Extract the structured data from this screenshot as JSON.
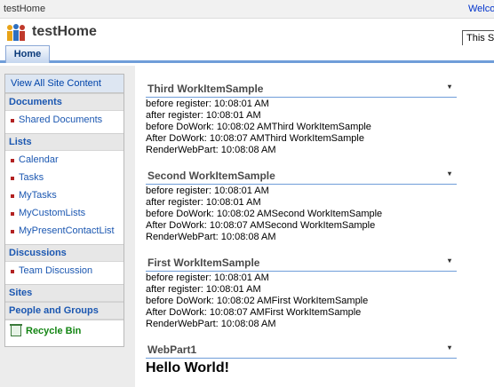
{
  "topbar": {
    "site_name": "testHome",
    "welcome_text": "Welcome"
  },
  "header": {
    "site_title": "testHome",
    "search_value": "This Site"
  },
  "tabs": [
    {
      "label": "Home"
    }
  ],
  "quicklaunch": {
    "view_all": "View All Site Content",
    "documents": {
      "heading": "Documents",
      "items": [
        "Shared Documents"
      ]
    },
    "lists": {
      "heading": "Lists",
      "items": [
        "Calendar",
        "Tasks",
        "MyTasks",
        "MyCustomLists",
        "MyPresentContactList"
      ]
    },
    "discussions": {
      "heading": "Discussions",
      "items": [
        "Team Discussion"
      ]
    },
    "sites": "Sites",
    "people_and_groups": "People and Groups",
    "recycle_bin": "Recycle Bin"
  },
  "webparts": [
    {
      "title": "Third WorkItemSample",
      "menu": "▾",
      "lines": [
        "before register: 10:08:01 AM",
        "after register: 10:08:01 AM",
        "before DoWork: 10:08:02 AMThird WorkItemSample",
        "After DoWork: 10:08:07 AMThird WorkItemSample",
        "RenderWebPart: 10:08:08 AM"
      ]
    },
    {
      "title": "Second WorkItemSample",
      "menu": "▾",
      "lines": [
        "before register: 10:08:01 AM",
        "after register: 10:08:01 AM",
        "before DoWork: 10:08:02 AMSecond WorkItemSample",
        "After DoWork: 10:08:07 AMSecond WorkItemSample",
        "RenderWebPart: 10:08:08 AM"
      ]
    },
    {
      "title": "First WorkItemSample",
      "menu": "▾",
      "lines": [
        "before register: 10:08:01 AM",
        "after register: 10:08:01 AM",
        "before DoWork: 10:08:02 AMFirst WorkItemSample",
        "After DoWork: 10:08:07 AMFirst WorkItemSample",
        "RenderWebPart: 10:08:08 AM"
      ]
    },
    {
      "title": "WebPart1",
      "menu": "▾",
      "hello": "Hello World!"
    }
  ]
}
